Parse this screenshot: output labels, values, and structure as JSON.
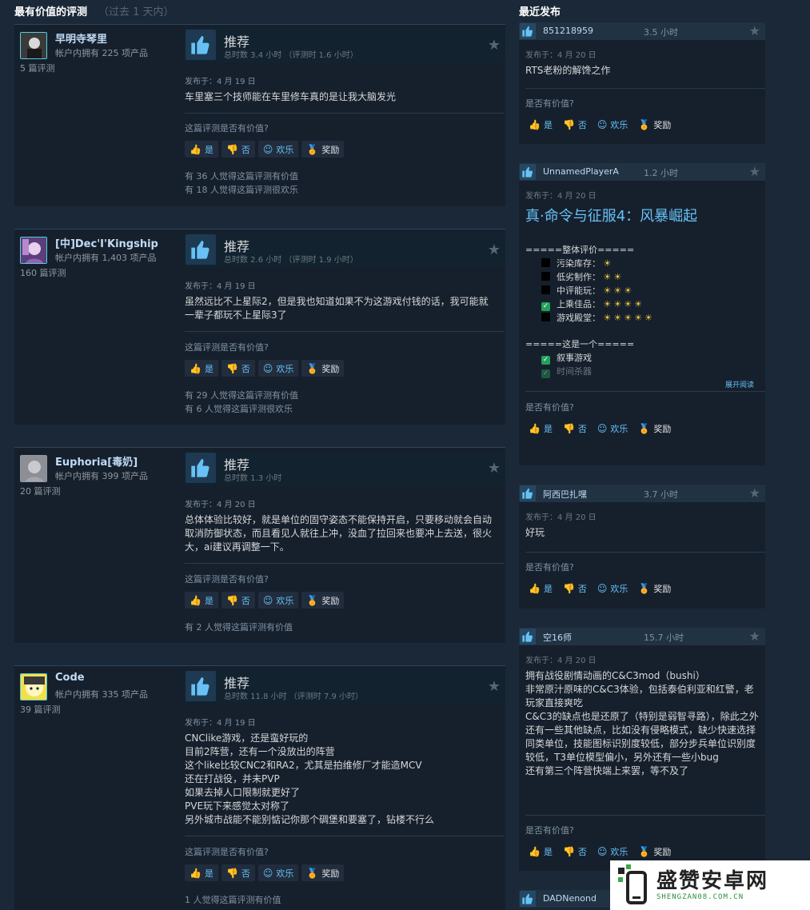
{
  "left_header": {
    "title": "最有价值的评测",
    "subtitle": "（过去 1 天内）"
  },
  "right_header": {
    "title": "最近发布"
  },
  "reviews": [
    {
      "author": "早明寺琴里",
      "owned": "帐户内拥有 225 项产品",
      "review_count": "5 篇评测",
      "verdict": "推荐",
      "hours": "总时数 3.4 小时 （评测时 1.6 小时）",
      "posted": "发布于：4 月 19 日",
      "text": "车里塞三个技师能在车里修车真的是让我大脑发光",
      "question": "这篇评测是否有价值?",
      "yes": "是",
      "no": "否",
      "funny": "欢乐",
      "award": "奖励",
      "stat1": "有 36 人觉得这篇评测有价值",
      "stat2": "有 18 人觉得这篇评测很欢乐"
    },
    {
      "author": "[中]Dec'I'Kingship",
      "owned": "帐户内拥有 1,403 项产品",
      "review_count": "160 篇评测",
      "verdict": "推荐",
      "hours": "总时数 2.6 小时 （评测时 1.9 小时）",
      "posted": "发布于：4 月 19 日",
      "text": "虽然远比不上星际2，但是我也知道如果不为这游戏付钱的话，我可能就一辈子都玩不上星际3了",
      "question": "这篇评测是否有价值?",
      "yes": "是",
      "no": "否",
      "funny": "欢乐",
      "award": "奖励",
      "stat1": "有 29 人觉得这篇评测有价值",
      "stat2": "有 6 人觉得这篇评测很欢乐"
    },
    {
      "author": "Euphoria[毒奶]",
      "owned": "帐户内拥有 399 项产品",
      "review_count": "20 篇评测",
      "verdict": "推荐",
      "hours": "总时数 1.3 小时",
      "posted": "发布于：4 月 20 日",
      "text": "总体体验比较好，就是单位的固守姿态不能保持开启，只要移动就会自动取消防御状态，而且看见人就往上冲，没血了拉回来也要冲上去送，很火大，ai建议再调整一下。",
      "question": "这篇评测是否有价值?",
      "yes": "是",
      "no": "否",
      "funny": "欢乐",
      "award": "奖励",
      "stat1": "有 2 人觉得这篇评测有价值",
      "stat2": ""
    },
    {
      "author": "Code",
      "owned": "帐户内拥有 335 项产品",
      "review_count": "39 篇评测",
      "verdict": "推荐",
      "hours": "总时数 11.8 小时 （评测时 7.9 小时）",
      "posted": "发布于：4 月 19 日",
      "text_lines": [
        "CNClike游戏，还是蛮好玩的",
        "目前2阵营，还有一个没放出的阵营",
        "这个like比较CNC2和RA2，尤其是拍维修厂才能造MCV",
        "还在打战役，并未PVP",
        "如果去掉人口限制就更好了",
        "PVE玩下来感觉太对称了",
        "另外城市战能不能别惦记你那个碉堡和要塞了，钻楼不行么"
      ],
      "question": "这篇评测是否有价值?",
      "yes": "是",
      "no": "否",
      "funny": "欢乐",
      "award": "奖励",
      "stat1": "1 人觉得这篇评测有价值",
      "stat2": ""
    }
  ],
  "recent": [
    {
      "name": "851218959",
      "hours": "3.5 小时",
      "posted": "发布于：4 月 20 日",
      "text": "RTS老粉的解馋之作",
      "question": "是否有价值?",
      "yes": "是",
      "no": "否",
      "funny": "欢乐",
      "award": "奖励"
    },
    {
      "name": "UnnamedPlayerA",
      "hours": "1.2 小时",
      "posted": "发布于：4 月 20 日",
      "heading": "真·命令与征服4：风暴崛起",
      "section1": "=====整体评价=====",
      "ratings": [
        {
          "label": "污染库存：",
          "suns": "☀",
          "checked": false
        },
        {
          "label": "低劣制作：",
          "suns": "☀☀",
          "checked": false
        },
        {
          "label": "中评能玩：",
          "suns": "☀☀☀",
          "checked": false
        },
        {
          "label": "上乘佳品：",
          "suns": "☀☀☀☀",
          "checked": true
        },
        {
          "label": "游戏殿堂：",
          "suns": "☀☀☀☀☀",
          "checked": false
        }
      ],
      "section2": "=====这是一个=====",
      "tags": [
        "叙事游戏",
        "时间杀器"
      ],
      "more": "展开阅读",
      "question": "是否有价值?",
      "yes": "是",
      "no": "否",
      "funny": "欢乐",
      "award": "奖励"
    },
    {
      "name": "阿西巴扎嘿",
      "hours": "3.7 小时",
      "posted": "发布于：4 月 20 日",
      "text": "好玩",
      "question": "是否有价值?",
      "yes": "是",
      "no": "否",
      "funny": "欢乐",
      "award": "奖励"
    },
    {
      "name": "空16师",
      "hours": "15.7 小时",
      "posted": "发布于：4 月 20 日",
      "text_lines": [
        "拥有战役剧情动画的C&C3mod（bushi）",
        "非常原汁原味的C&C3体验，包括泰伯利亚和红警，老玩家直接爽吃",
        "C&C3的缺点也是还原了（特别是弱智寻路），除此之外还有一些其他缺点，比如没有侵略模式，缺少快速选择同类单位，技能图标识别度较低，部分步兵单位识别度较低，T3单位模型偏小，另外还有一些小bug",
        "还有第三个阵营快端上来罢，等不及了"
      ],
      "question": "是否有价值?",
      "yes": "是",
      "no": "否",
      "funny": "欢乐",
      "award": "奖励"
    },
    {
      "name": "DADNenond"
    }
  ],
  "watermark": {
    "title": "盛赞安卓网",
    "url": "SHENGZAN08.COM.CN"
  }
}
